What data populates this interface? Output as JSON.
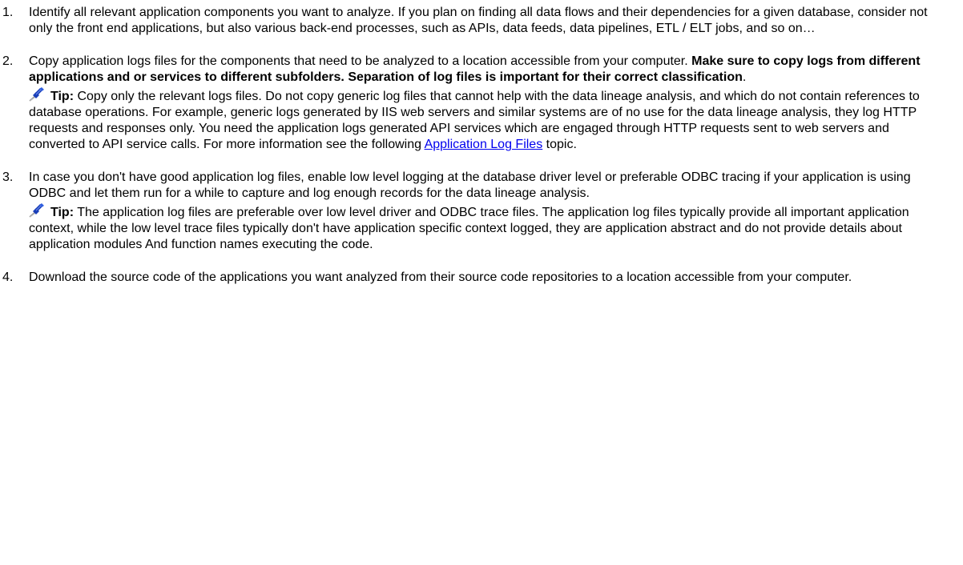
{
  "steps": [
    {
      "number": "1.",
      "text": "Identify all relevant application components you want to analyze. If you plan on finding all data flows and their dependencies for a given database, consider not only the front end applications, but also various back-end processes, such as APIs, data feeds, data pipelines, ETL / ELT jobs, and so on…"
    },
    {
      "number": "2.",
      "text": "Copy application logs files for the components that need to be analyzed to a location accessible from your computer. ",
      "bold_text": "Make sure to copy logs from different applications and or services to different subfolders. Separation of log files is important for their correct classification",
      "text_end": ".",
      "tip": {
        "icon": "pushpin-icon",
        "label": "Tip:",
        "text_before": " Copy only the relevant logs files. Do not copy generic log files that cannot help with the data lineage analysis, and which do not contain references to database operations. For example, generic logs generated by IIS web servers and similar systems are of no use for the data lineage analysis, they log HTTP requests and responses only. You need the application logs generated API services which are engaged through HTTP requests sent to web servers and converted to API service calls. For more information see the following ",
        "link_text": "Application Log Files",
        "text_after": " topic."
      }
    },
    {
      "number": "3.",
      "text": "In case you don't have good application log files, enable low level logging at the database driver level or preferable ODBC tracing if your application is using ODBC and let them run for a while to capture and log enough records for the data lineage analysis.",
      "tip": {
        "icon": "pushpin-icon",
        "label": "Tip:",
        "text": " The application log files are preferable over low level driver and ODBC trace files. The application log files typically provide all important application context, while the low level trace files typically don't have application specific context logged, they are application abstract and do not provide details about application modules And function names executing the code."
      }
    },
    {
      "number": "4.",
      "text": "Download the source code of the applications you want analyzed from their source code repositories to a location accessible from your computer."
    }
  ],
  "colors": {
    "text": "#000000",
    "link": "#0000ee",
    "pin_blue": "#1a3fb8",
    "pin_gray": "#9a9a9a"
  }
}
